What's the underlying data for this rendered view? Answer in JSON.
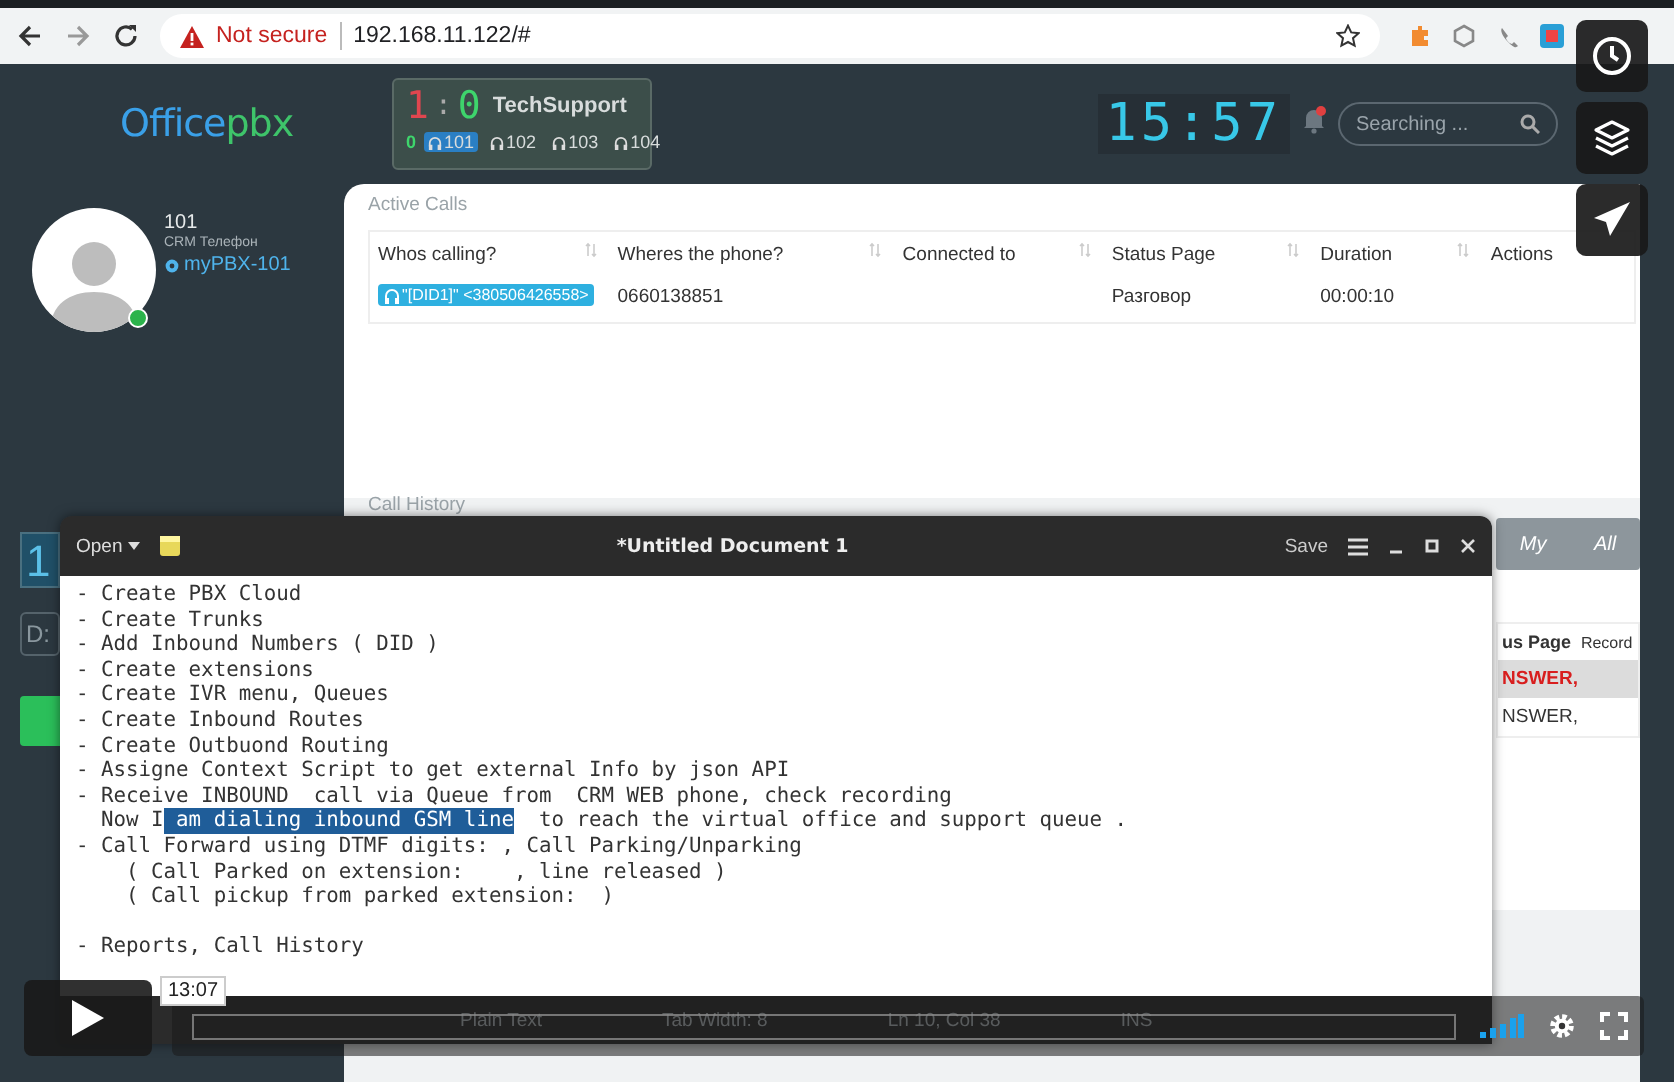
{
  "browser": {
    "security_label": "Not secure",
    "url": "192.168.11.122/#"
  },
  "header": {
    "logo": {
      "first": "Office",
      "second": "pbx"
    },
    "queue": {
      "waiting": "1",
      "separator": ":",
      "answered": "0",
      "name": "TechSupport",
      "free_count": "0",
      "agents": [
        {
          "extension": "101",
          "active": true
        },
        {
          "extension": "102",
          "active": false
        },
        {
          "extension": "103",
          "active": false
        },
        {
          "extension": "104",
          "active": false
        }
      ]
    },
    "clock": "15:57",
    "notification": true,
    "search": {
      "placeholder": "Searching ..."
    }
  },
  "profile": {
    "extension": "101",
    "subtitle": "CRM Телефон",
    "account": "myPBX-101",
    "online": true
  },
  "side_controls": {
    "display": "1",
    "field": "D:"
  },
  "active_calls": {
    "title": "Active Calls",
    "columns": [
      "Whos calling?",
      "Wheres the phone?",
      "Connected to",
      "Status Page",
      "Duration",
      "Actions"
    ],
    "rows": [
      {
        "caller": "\"[DID1]\" <380506426558>",
        "phone": "0660138851",
        "status": "Разговор",
        "duration": "00:00:10"
      }
    ]
  },
  "call_history": {
    "title": "Call History",
    "tabs": [
      {
        "label": "My",
        "selected": false
      },
      {
        "label": "All",
        "selected": false
      }
    ],
    "columns": [
      "us Page",
      "Record"
    ],
    "rows": [
      {
        "status": "NSWER,",
        "highlighted": true
      },
      {
        "status": "NSWER,",
        "highlighted": false
      }
    ]
  },
  "editor": {
    "open_label": "Open",
    "title": "*Untitled Document 1",
    "save_label": "Save",
    "paragraphs": [
      {
        "lines": [
          {
            "segments": [
              {
                "text": "- Create PBX Cloud",
                "selected": false
              }
            ]
          },
          {
            "segments": [
              {
                "text": "- Create Trunks",
                "selected": false
              }
            ]
          },
          {
            "segments": [
              {
                "text": "- Add Inbound Numbers ( DID )",
                "selected": false
              }
            ]
          },
          {
            "segments": [
              {
                "text": "- Create extensions",
                "selected": false
              }
            ]
          },
          {
            "segments": [
              {
                "text": "- Create IVR menu, Queues",
                "selected": false
              }
            ]
          },
          {
            "segments": [
              {
                "text": "- Create Inbound Routes",
                "selected": false
              }
            ]
          },
          {
            "segments": [
              {
                "text": "- Create Outbuond Routing",
                "selected": false
              }
            ]
          },
          {
            "segments": [
              {
                "text": "- Assigne Context Script to get external Info by json API",
                "selected": false
              }
            ]
          },
          {
            "segments": [
              {
                "text": "- Receive INBOUND  call via Queue from  CRM WEB phone, check recording",
                "selected": false
              }
            ]
          },
          {
            "segments": [
              {
                "text": "  Now I",
                "selected": false
              },
              {
                "text": " am dialing inbound GSM line",
                "selected": true
              },
              {
                "text": "  to reach the virtual office and support queue .",
                "selected": false
              }
            ]
          },
          {
            "segments": [
              {
                "text": "- Call Forward using DTMF digits: , Call Parking/Unparking",
                "selected": false
              }
            ]
          },
          {
            "segments": [
              {
                "text": "    ( Call Parked on extension:    , line released )",
                "selected": false
              }
            ]
          },
          {
            "segments": [
              {
                "text": "    ( Call pickup from parked extension:  )",
                "selected": false
              }
            ]
          }
        ]
      },
      {
        "lines": [
          {
            "segments": [
              {
                "text": "- Reports, Call History",
                "selected": false
              }
            ]
          }
        ]
      }
    ],
    "status": {
      "language": "Plain Text",
      "tab_width": "Tab Width: 8",
      "position": "Ln 10, Col 38",
      "mode": "INS"
    }
  },
  "player": {
    "time": "13:07"
  }
}
